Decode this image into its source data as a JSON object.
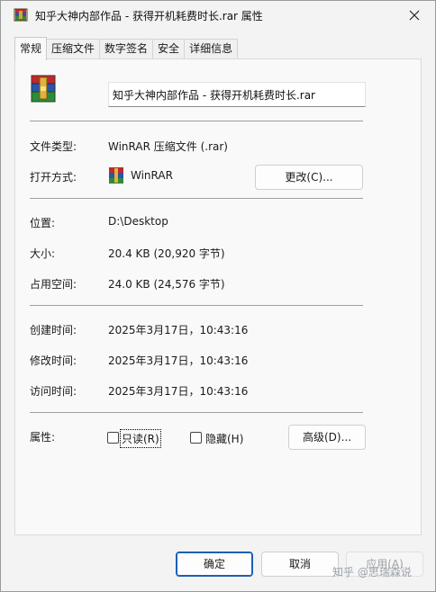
{
  "window": {
    "title": "知乎大神内部作品 - 获得开机耗费时长.rar 属性"
  },
  "tabs": [
    {
      "label": "常规"
    },
    {
      "label": "压缩文件"
    },
    {
      "label": "数字签名"
    },
    {
      "label": "安全"
    },
    {
      "label": "详细信息"
    }
  ],
  "general": {
    "file_name": "知乎大神内部作品 - 获得开机耗费时长.rar",
    "type_label": "文件类型:",
    "type_value": "WinRAR 压缩文件 (.rar)",
    "open_with_label": "打开方式:",
    "open_with_value": "WinRAR",
    "change_button": "更改(C)...",
    "location_label": "位置:",
    "location_value": "D:\\Desktop",
    "size_label": "大小:",
    "size_value": "20.4 KB (20,920 字节)",
    "disk_size_label": "占用空间:",
    "disk_size_value": "24.0 KB (24,576 字节)",
    "created_label": "创建时间:",
    "created_value": "2025年3月17日，10:43:16",
    "modified_label": "修改时间:",
    "modified_value": "2025年3月17日，10:43:16",
    "accessed_label": "访问时间:",
    "accessed_value": "2025年3月17日，10:43:16",
    "attributes_label": "属性:",
    "readonly_label": "只读(R)",
    "readonly_checked": false,
    "hidden_label": "隐藏(H)",
    "hidden_checked": false,
    "advanced_button": "高级(D)..."
  },
  "footer": {
    "ok": "确定",
    "cancel": "取消",
    "apply": "应用(A)"
  },
  "watermark": "知乎 @思瑞森说",
  "colors": {
    "accent": "#1a5fb4",
    "winrar_red": "#c0282f",
    "winrar_blue": "#2b55a8",
    "winrar_green": "#2f8a3c"
  }
}
